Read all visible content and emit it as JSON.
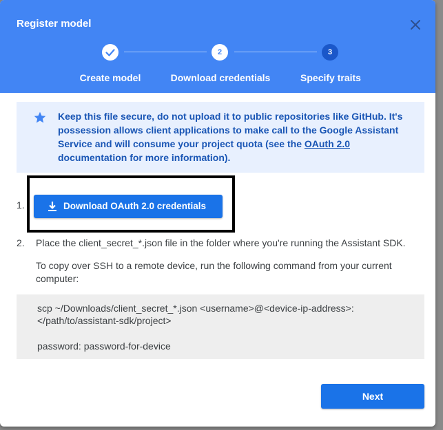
{
  "dialog": {
    "title": "Register model",
    "steps": [
      {
        "number": "1",
        "label": "Create model",
        "state": "completed"
      },
      {
        "number": "2",
        "label": "Download credentials",
        "state": "current"
      },
      {
        "number": "3",
        "label": "Specify traits",
        "state": "upcoming"
      }
    ],
    "info": {
      "text_before_link": "Keep this file secure, do not upload it to public repositories like GitHub. It's possession allows client applications to make call to the Google Assistant Service and will consume your project quota (see the ",
      "link_text": "OAuth 2.0",
      "text_after_link": " documentation for more information)."
    },
    "instructions": {
      "item1_number": "1.",
      "download_button_label": "Download OAuth 2.0 credentials",
      "item2_number": "2.",
      "item2_text": "Place the client_secret_*.json file in the folder where you're running the Assistant SDK.",
      "ssh_text": "To copy over SSH to a remote device, run the following command from your current computer:"
    },
    "code": {
      "line1": "scp ~/Downloads/client_secret_*.json <username>@<device-ip-address>:",
      "line2": "</path/to/assistant-sdk/project>",
      "line3": "password: password-for-device"
    },
    "next_label": "Next"
  },
  "colors": {
    "header": "#4285f4",
    "primary_button": "#1a73e8",
    "info_background": "#e8f0fe",
    "info_text": "#1a56b5",
    "code_background": "#eeeeee"
  },
  "icons": {
    "close": "close-icon",
    "check": "check-icon",
    "star": "star-icon",
    "download": "download-icon"
  }
}
